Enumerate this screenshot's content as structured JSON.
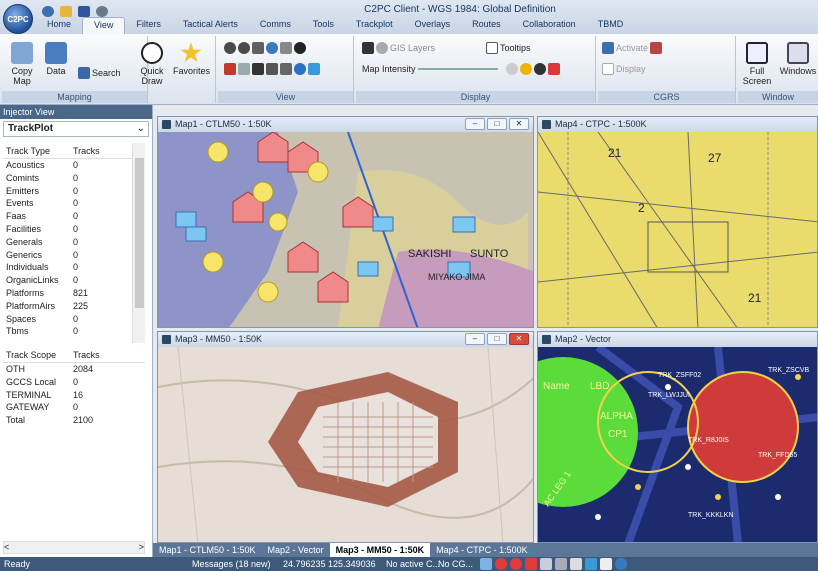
{
  "app": {
    "title": "C2PC Client - WGS 1984: Global Definition",
    "orb_label": "C2PC"
  },
  "tabs": [
    "Home",
    "View",
    "Filters",
    "Tactical Alerts",
    "Comms",
    "Tools",
    "Trackplot",
    "Overlays",
    "Routes",
    "Collaboration",
    "TBMD"
  ],
  "ribbon": {
    "mapping": {
      "label": "Mapping",
      "copy_map": "Copy Map",
      "data": "Data",
      "search": "Search",
      "quick_draw": "Quick Draw",
      "favorites": "Favorites"
    },
    "view": {
      "label": "View"
    },
    "display": {
      "label": "Display",
      "gis_layers": "GIS Layers",
      "tooltips": "Tooltips",
      "map_intensity": "Map Intensity"
    },
    "cgrs": {
      "label": "CGRS",
      "activate": "Activate",
      "display": "Display"
    },
    "window": {
      "label": "Window",
      "full_screen": "Full Screen",
      "windows": "Windows"
    }
  },
  "injector": {
    "title": "Injector View",
    "dropdown": "TrackPlot",
    "type_header": [
      "Track Type",
      "Tracks"
    ],
    "types": [
      [
        "Acoustics",
        "0"
      ],
      [
        "Comints",
        "0"
      ],
      [
        "Emitters",
        "0"
      ],
      [
        "Events",
        "0"
      ],
      [
        "Faas",
        "0"
      ],
      [
        "Facilities",
        "0"
      ],
      [
        "Generals",
        "0"
      ],
      [
        "Generics",
        "0"
      ],
      [
        "Individuals",
        "0"
      ],
      [
        "OrganicLinks",
        "0"
      ],
      [
        "Platforms",
        "821"
      ],
      [
        "PlatformAirs",
        "225"
      ],
      [
        "Spaces",
        "0"
      ],
      [
        "Tbms",
        "0"
      ]
    ],
    "scope_header": [
      "Track Scope",
      "Tracks"
    ],
    "scopes": [
      [
        "OTH",
        "2084"
      ],
      [
        "GCCS Local",
        "0"
      ],
      [
        "TERMINAL",
        "16"
      ],
      [
        "GATEWAY",
        "0"
      ],
      [
        "Total",
        "2100"
      ]
    ]
  },
  "maps": {
    "map1": {
      "title": "Map1 - CTLM50 - 1:50K",
      "labels": [
        "SAKISHI",
        "SUNTO",
        "MIYAKO JIMA"
      ]
    },
    "map4": {
      "title": "Map4 - CTPC - 1:500K",
      "labels": [
        "21",
        "27",
        "21",
        "2"
      ]
    },
    "map3": {
      "title": "Map3 - MM50 - 1:50K"
    },
    "map2": {
      "title": "Map2 - Vector",
      "labels": [
        "Name",
        "LBD",
        "ALPHA",
        "CP1",
        "AC LEG 1",
        "TRK_ZSFF02",
        "TRK_LWJJUI",
        "TRK_R8J0IS",
        "TRK_FFD55",
        "TRK_KKKLKN",
        "TRK_ZSCVB"
      ]
    }
  },
  "doc_tabs": [
    "Map1 - CTLM50 - 1:50K",
    "Map2 - Vector",
    "Map3 - MM50 - 1:50K",
    "Map4 - CTPC - 1:500K"
  ],
  "status": {
    "ready": "Ready",
    "messages": "Messages (18 new)",
    "coords": "24.796235 125.349036",
    "no_active": "No active C...",
    "no_cg": "No CG..."
  },
  "colors": {
    "titlebar": "#dfe7f2",
    "panel_head": "#4a6787",
    "status_bar": "#3e5a7a",
    "map_green": "#5bdc3a",
    "map_navy": "#1c2a6e"
  }
}
